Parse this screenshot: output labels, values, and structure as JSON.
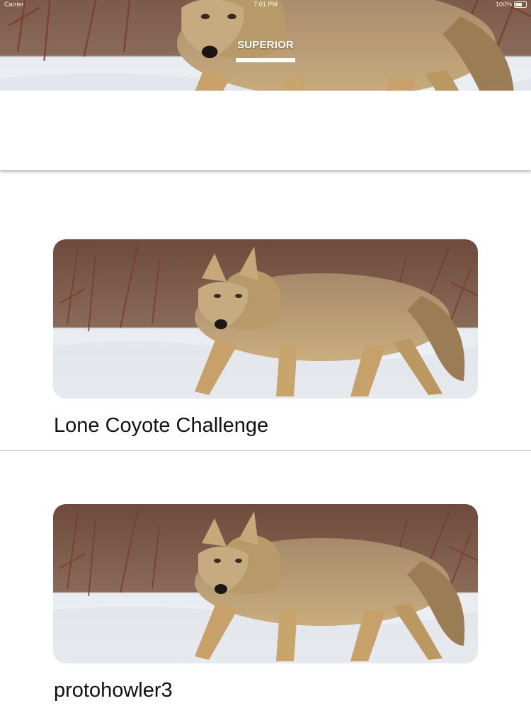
{
  "status_bar": {
    "carrier": "Carrier",
    "time": "7:01 PM",
    "battery": "100%"
  },
  "header": {
    "tab_label": "SUPERIOR",
    "image_icon": "coyote-photo"
  },
  "challenges": [
    {
      "title": "Lone Coyote Challenge",
      "image_icon": "coyote-photo"
    },
    {
      "title": "protohowler3",
      "image_icon": "coyote-photo"
    }
  ],
  "colors": {
    "background": "#ffffff",
    "tab_indicator": "#ffffff",
    "divider": "#cfcfcf",
    "snow": "#e9edf1",
    "fur": "#b89a6a"
  }
}
